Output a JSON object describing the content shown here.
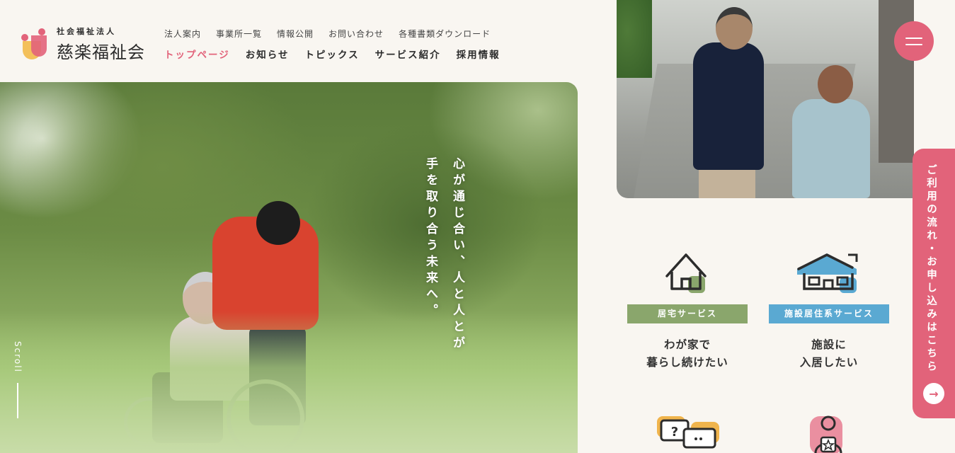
{
  "brand": {
    "sub": "社会福祉法人",
    "name": "慈楽福祉会"
  },
  "nav": {
    "sub": [
      "法人案内",
      "事業所一覧",
      "情報公開",
      "お問い合わせ",
      "各種書類ダウンロード"
    ],
    "main": [
      "トップページ",
      "お知らせ",
      "トピックス",
      "サービス紹介",
      "採用情報"
    ],
    "active_index": 0
  },
  "hero": {
    "catch_line1": "心が通じ合い、人と人とが",
    "catch_line2": "手を取り合う未来へ。",
    "scroll_label": "Scroll"
  },
  "apply_tab": {
    "label": "ご利用の流れ・お申し込みはこちら",
    "arrow": "→"
  },
  "services": [
    {
      "tag": "居宅サービス",
      "desc": "わが家で\n暮らし続けたい",
      "icon": "home-icon",
      "tag_color": "#8aa66c"
    },
    {
      "tag": "施設居住系サービス",
      "desc": "施設に\n入居したい",
      "icon": "facility-icon",
      "tag_color": "#5aa9d2"
    }
  ],
  "colors": {
    "accent": "#e2637a",
    "yellow": "#f3c05b",
    "green": "#8aa66c",
    "blue": "#5aa9d2",
    "background": "#f9f6f1"
  }
}
